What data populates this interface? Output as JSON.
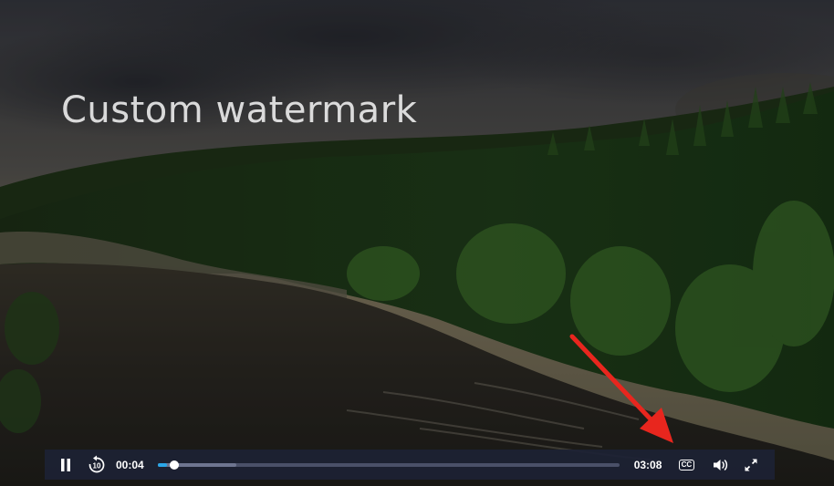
{
  "video": {
    "watermark_text": "Custom watermark",
    "scene": "forest river landscape"
  },
  "controls": {
    "play_state": "playing",
    "pause_icon": "pause-icon",
    "rewind_icon": "rewind-10-icon",
    "rewind_seconds": "10",
    "current_time": "00:04",
    "duration": "03:08",
    "progress_fraction": 0.021,
    "buffered_fraction": 0.17,
    "cc_label": "CC",
    "volume_icon": "volume-icon",
    "fullscreen_icon": "fullscreen-icon"
  },
  "annotation": {
    "arrow_color": "#e8261e",
    "arrow_target": "cc-button"
  },
  "colors": {
    "control_bar_bg": "#1c2234",
    "progress_played": "#2aa6e8"
  }
}
